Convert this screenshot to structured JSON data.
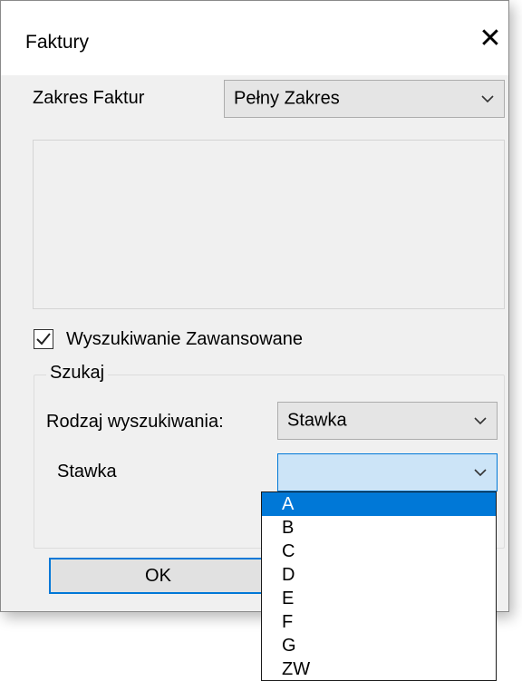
{
  "window": {
    "title": "Faktury",
    "close_icon": "close-icon"
  },
  "zakres": {
    "label": "Zakres Faktur",
    "value": "Pełny Zakres"
  },
  "advanced_search": {
    "label": "Wyszukiwanie Zawansowane",
    "checked": true
  },
  "group": {
    "legend": "Szukaj",
    "rodzaj_label": "Rodzaj wyszukiwania:",
    "rodzaj_value": "Stawka",
    "stawka_label": "Stawka",
    "stawka_value": ""
  },
  "buttons": {
    "ok": "OK"
  },
  "dropdown": {
    "options": [
      "A",
      "B",
      "C",
      "D",
      "E",
      "F",
      "G",
      "ZW"
    ],
    "selected_index": 0
  },
  "colors": {
    "accent": "#0078d7",
    "dialog_bg": "#f0f0f0",
    "focus_field": "#cce4f7"
  }
}
